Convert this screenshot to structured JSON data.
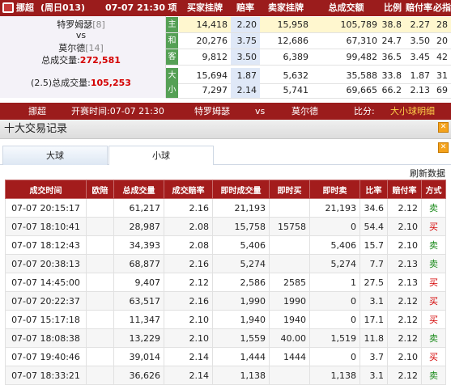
{
  "header": {
    "league": "挪超",
    "match_code": "(周日013)",
    "datetime": "07-07 21:30",
    "col_item": "项",
    "col_buy_listing": "买家挂牌",
    "col_odds": "赔率",
    "col_sell_listing": "卖家挂牌",
    "col_total_volume": "总成交额",
    "col_ratio": "比例",
    "col_payout": "赔付率",
    "col_loss": "必指"
  },
  "match_info": {
    "home_team": "特罗姆瑟",
    "home_rank": "[8]",
    "vs": "vs",
    "away_team": "莫尔德",
    "away_rank": "[14]",
    "total_volume_label": "总成交量:",
    "total_volume_value": "272,581",
    "handicap_label": "(2.5)总成交量:",
    "handicap_volume_value": "105,253"
  },
  "top_rows": [
    {
      "label": "主",
      "buy": "14,418",
      "odds": "2.20",
      "sell": "15,958",
      "total": "105,789",
      "ratio": "38.8",
      "payout": "2.27",
      "last": "28"
    },
    {
      "label": "和",
      "buy": "20,276",
      "odds": "3.75",
      "sell": "12,686",
      "total": "67,310",
      "ratio": "24.7",
      "payout": "3.50",
      "last": "20"
    },
    {
      "label": "客",
      "buy": "9,812",
      "odds": "3.50",
      "sell": "6,389",
      "total": "99,482",
      "ratio": "36.5",
      "payout": "3.45",
      "last": "42"
    },
    {
      "label": "大",
      "buy": "15,694",
      "odds": "1.87",
      "sell": "5,632",
      "total": "35,588",
      "ratio": "33.8",
      "payout": "1.87",
      "last": "31"
    },
    {
      "label": "小",
      "buy": "7,297",
      "odds": "2.14",
      "sell": "5,741",
      "total": "69,665",
      "ratio": "66.2",
      "payout": "2.13",
      "last": "69"
    }
  ],
  "match_bar": {
    "league": "挪超",
    "start_label": "开赛时间:07-07 21:30",
    "home": "特罗姆瑟",
    "vs": "vs",
    "away": "莫尔德",
    "score_label": "比分:",
    "detail_link": "大小球明细"
  },
  "section": {
    "title": "十大交易记录"
  },
  "tabs": [
    {
      "label": "大球",
      "active": false
    },
    {
      "label": "小球",
      "active": true
    }
  ],
  "refresh_label": "刷新数据",
  "table": {
    "headers": [
      "成交时间",
      "欧陪",
      "总成交量",
      "成交赔率",
      "即时成交量",
      "即时买",
      "即时卖",
      "比率",
      "赔付率",
      "方式"
    ],
    "rows": [
      [
        "07-07 20:15:17",
        "",
        "61,217",
        "2.16",
        "21,193",
        "",
        "21,193",
        "34.6",
        "2.12",
        "卖"
      ],
      [
        "07-07 18:10:41",
        "",
        "28,987",
        "2.08",
        "15,758",
        "15758",
        "0",
        "54.4",
        "2.10",
        "买"
      ],
      [
        "07-07 18:12:43",
        "",
        "34,393",
        "2.08",
        "5,406",
        "",
        "5,406",
        "15.7",
        "2.10",
        "卖"
      ],
      [
        "07-07 20:38:13",
        "",
        "68,877",
        "2.16",
        "5,274",
        "",
        "5,274",
        "7.7",
        "2.13",
        "卖"
      ],
      [
        "07-07 14:45:00",
        "",
        "9,407",
        "2.12",
        "2,586",
        "2585",
        "1",
        "27.5",
        "2.13",
        "买"
      ],
      [
        "07-07 20:22:37",
        "",
        "63,517",
        "2.16",
        "1,990",
        "1990",
        "0",
        "3.1",
        "2.12",
        "买"
      ],
      [
        "07-07 15:17:18",
        "",
        "11,347",
        "2.10",
        "1,940",
        "1940",
        "0",
        "17.1",
        "2.12",
        "买"
      ],
      [
        "07-07 18:08:38",
        "",
        "13,229",
        "2.10",
        "1,559",
        "40.00",
        "1,519",
        "11.8",
        "2.12",
        "卖"
      ],
      [
        "07-07 19:40:46",
        "",
        "39,014",
        "2.14",
        "1,444",
        "1444",
        "0",
        "3.7",
        "2.10",
        "买"
      ],
      [
        "07-07 18:33:21",
        "",
        "36,626",
        "2.14",
        "1,138",
        "",
        "1,138",
        "3.1",
        "2.12",
        "卖"
      ]
    ]
  },
  "colors": {
    "brand_red": "#9b1c1c",
    "buy_red": "#d40000",
    "sell_green": "#1a8a1a",
    "highlight_yellow": "#fff7cf",
    "highlight_blue": "#dfe8f7"
  }
}
